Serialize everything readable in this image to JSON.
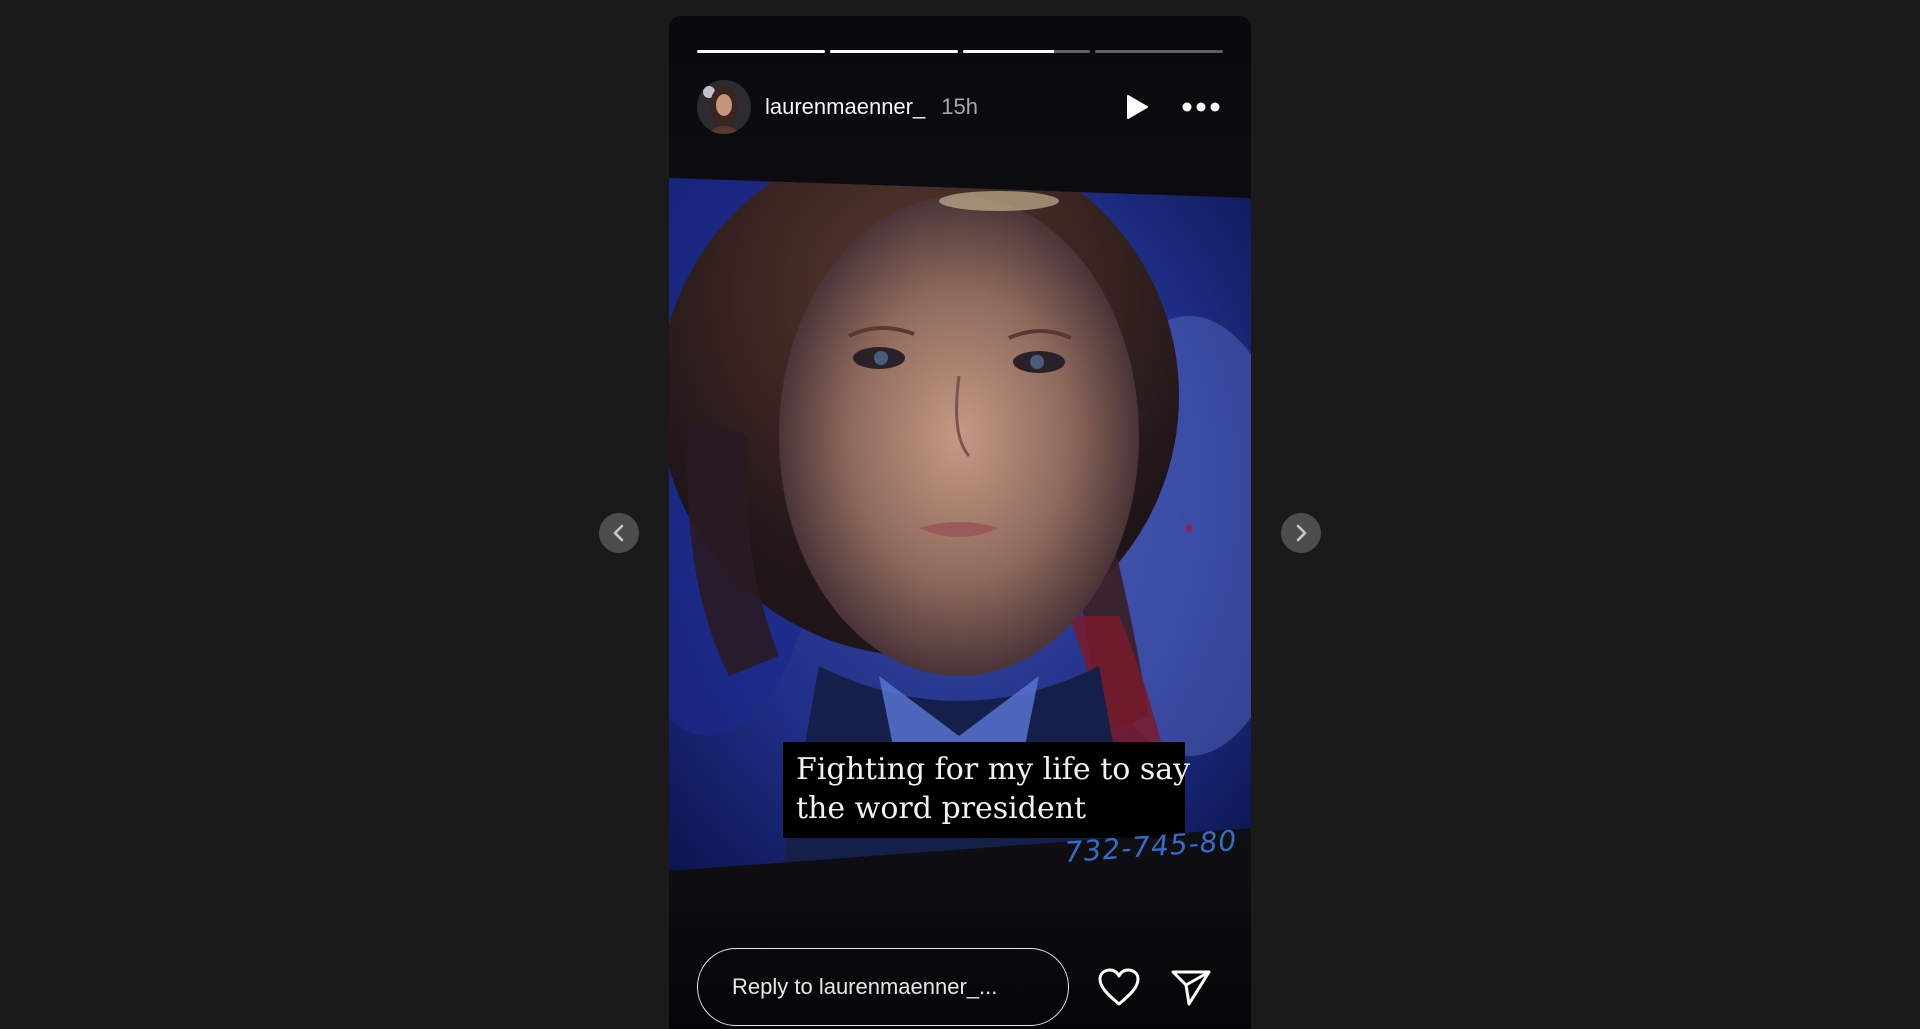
{
  "story": {
    "progress": [
      1.0,
      1.0,
      0.72,
      0.0
    ],
    "author": {
      "username": "laurenmaenner_",
      "time_ago": "15h",
      "avatar_icon": "profile-photo"
    },
    "controls": {
      "play_icon": "play-icon",
      "more_icon": "more-options-icon"
    },
    "caption": {
      "line1": "Fighting for my life to say",
      "line2": "the word president"
    },
    "background_text": "732-745-80",
    "reply": {
      "placeholder": "Reply to laurenmaenner_..."
    },
    "actions": {
      "like_icon": "heart-icon",
      "share_icon": "send-icon"
    }
  },
  "navigation": {
    "prev_icon": "chevron-left-icon",
    "next_icon": "chevron-right-icon"
  },
  "colors": {
    "page_background": "#1a1a1a",
    "story_background": "#08080b",
    "caption_background": "#000000",
    "nav_button": "#4d4d4d"
  }
}
